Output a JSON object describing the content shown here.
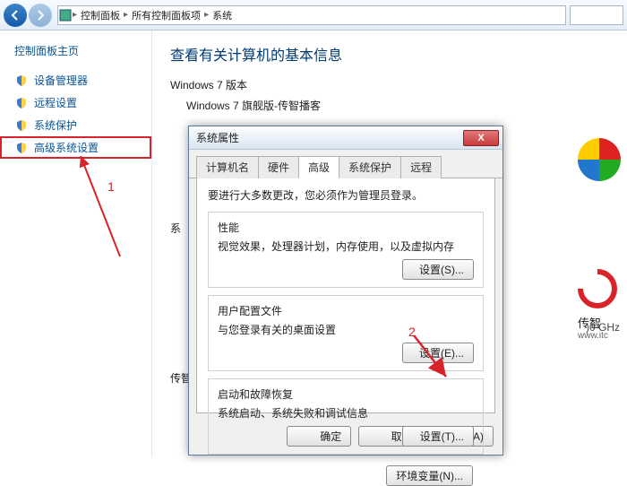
{
  "toolbar": {
    "breadcrumbs": [
      "控制面板",
      "所有控制面板项",
      "系统"
    ]
  },
  "sidebar": {
    "home": "控制面板主页",
    "items": [
      {
        "label": "设备管理器"
      },
      {
        "label": "远程设置"
      },
      {
        "label": "系统保护"
      },
      {
        "label": "高级系统设置"
      }
    ]
  },
  "page": {
    "title": "查看有关计算机的基本信息",
    "edition_label": "Windows 7 版本",
    "edition_value": "Windows 7 旗舰版-传智播客",
    "system_label": "系",
    "brand_label": "传智",
    "freq_hint": ")0 GHz",
    "brand_url": "www.itc"
  },
  "annotations": {
    "label1": "1",
    "label2": "2"
  },
  "dialog": {
    "title": "系统属性",
    "close": "X",
    "tabs": [
      "计算机名",
      "硬件",
      "高级",
      "系统保护",
      "远程"
    ],
    "active_tab": 2,
    "notice": "要进行大多数更改，您必须作为管理员登录。",
    "groups": [
      {
        "title": "性能",
        "desc": "视觉效果，处理器计划，内存使用，以及虚拟内存",
        "button": "设置(S)..."
      },
      {
        "title": "用户配置文件",
        "desc": "与您登录有关的桌面设置",
        "button": "设置(E)..."
      },
      {
        "title": "启动和故障恢复",
        "desc": "系统启动、系统失败和调试信息",
        "button": "设置(T)..."
      }
    ],
    "env_button": "环境变量(N)...",
    "footer": {
      "ok": "确定",
      "cancel": "取消",
      "apply": "应用(A)"
    }
  }
}
